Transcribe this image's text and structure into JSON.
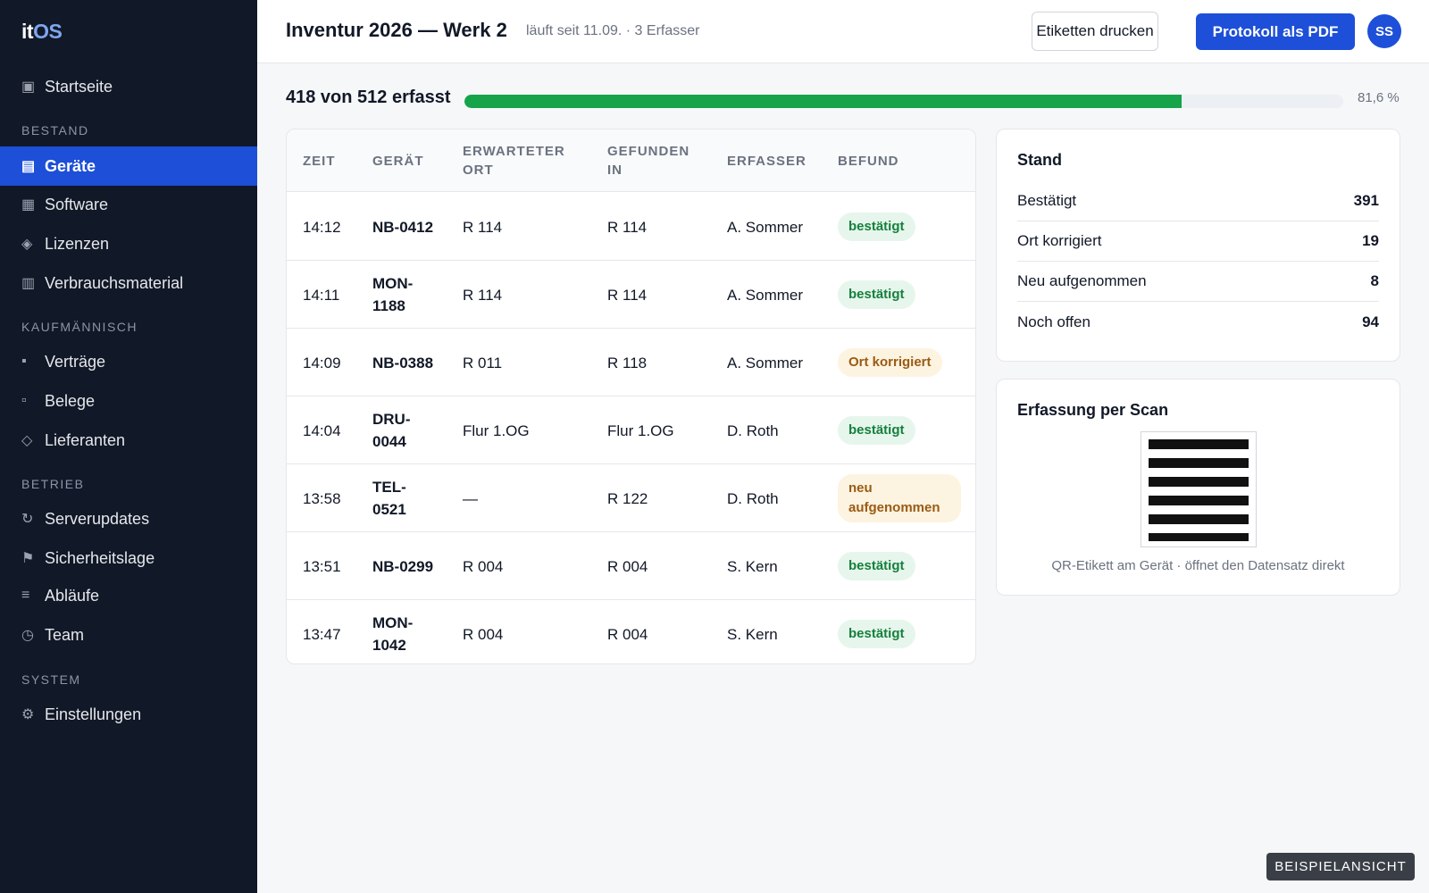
{
  "app": {
    "logo_part1": "it",
    "logo_part2": "OS"
  },
  "sidebar": {
    "home": {
      "icon": "dashboard-icon",
      "label": "Startseite"
    },
    "sections": [
      {
        "title": "BESTAND",
        "items": [
          {
            "icon": "devices-icon",
            "label": "Geräte",
            "active": true
          },
          {
            "icon": "software-icon",
            "label": "Software"
          },
          {
            "icon": "license-icon",
            "label": "Lizenzen"
          },
          {
            "icon": "consumables-icon",
            "label": "Verbrauchsmaterial"
          }
        ]
      },
      {
        "title": "KAUFMÄNNISCH",
        "items": [
          {
            "icon": "contracts-icon",
            "label": "Verträge"
          },
          {
            "icon": "receipts-icon",
            "label": "Belege"
          },
          {
            "icon": "suppliers-icon",
            "label": "Lieferanten"
          }
        ]
      },
      {
        "title": "BETRIEB",
        "items": [
          {
            "icon": "refresh-icon",
            "label": "Serverupdates"
          },
          {
            "icon": "flag-icon",
            "label": "Sicherheitslage"
          },
          {
            "icon": "list-icon",
            "label": "Abläufe"
          },
          {
            "icon": "clock-icon",
            "label": "Team"
          }
        ]
      },
      {
        "title": "SYSTEM",
        "items": [
          {
            "icon": "gear-icon",
            "label": "Einstellungen"
          }
        ]
      }
    ]
  },
  "header": {
    "title": "Inventur 2026 — Werk 2",
    "subtitle": "läuft seit 11.09. · 3 Erfasser",
    "print_labels_button": "Etiketten drucken",
    "pdf_button": "Protokoll als PDF",
    "avatar_initials": "SS"
  },
  "progress": {
    "label": "418 von 512 erfasst",
    "fraction": 0.8164,
    "percent_text": "81,6 %",
    "fill_color": "#16a34a"
  },
  "table": {
    "columns": [
      "ZEIT",
      "GERÄT",
      "ERWARTETER ORT",
      "GEFUNDEN IN",
      "ERFASSER",
      "BEFUND"
    ],
    "rows": [
      {
        "zeit": "14:12",
        "geraet": "NB-0412",
        "erwartet": "R 114",
        "gefunden": "R 114",
        "erfasser": "A. Sommer",
        "befund": "bestätigt",
        "status": "ok"
      },
      {
        "zeit": "14:11",
        "geraet": "MON-1188",
        "erwartet": "R 114",
        "gefunden": "R 114",
        "erfasser": "A. Sommer",
        "befund": "bestätigt",
        "status": "ok"
      },
      {
        "zeit": "14:09",
        "geraet": "NB-0388",
        "erwartet": "R 011",
        "gefunden": "R 118",
        "erfasser": "A. Sommer",
        "befund": "Ort korrigiert",
        "status": "warn"
      },
      {
        "zeit": "14:04",
        "geraet": "DRU-0044",
        "erwartet": "Flur 1.OG",
        "gefunden": "Flur 1.OG",
        "erfasser": "D. Roth",
        "befund": "bestätigt",
        "status": "ok"
      },
      {
        "zeit": "13:58",
        "geraet": "TEL-0521",
        "erwartet": "—",
        "gefunden": "R 122",
        "erfasser": "D. Roth",
        "befund": "neu aufgenommen",
        "status": "warn"
      },
      {
        "zeit": "13:51",
        "geraet": "NB-0299",
        "erwartet": "R 004",
        "gefunden": "R 004",
        "erfasser": "S. Kern",
        "befund": "bestätigt",
        "status": "ok"
      },
      {
        "zeit": "13:47",
        "geraet": "MON-1042",
        "erwartet": "R 004",
        "gefunden": "R 004",
        "erfasser": "S. Kern",
        "befund": "bestätigt",
        "status": "ok"
      }
    ]
  },
  "stand": {
    "title": "Stand",
    "stats": [
      {
        "label": "Bestätigt",
        "value": "391"
      },
      {
        "label": "Ort korrigiert",
        "value": "19"
      },
      {
        "label": "Neu aufgenommen",
        "value": "8"
      },
      {
        "label": "Noch offen",
        "value": "94"
      }
    ]
  },
  "scan": {
    "title": "Erfassung per Scan",
    "caption": "QR-Etikett am Gerät · öffnet den Datensatz direkt"
  },
  "watermark": "BEISPIELANSICHT"
}
